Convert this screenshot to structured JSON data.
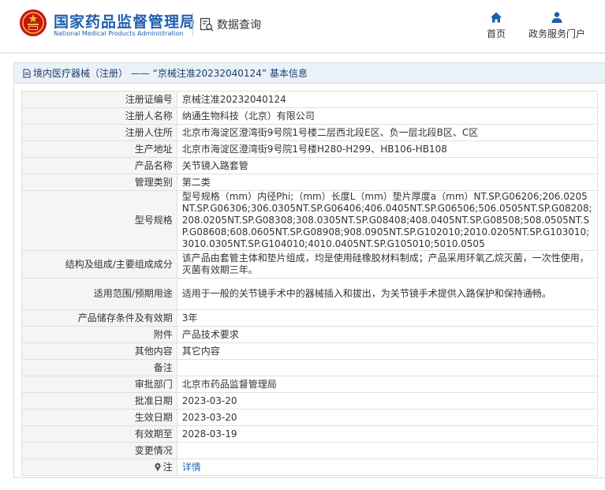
{
  "header": {
    "title": "国家药品监督管理局",
    "subtitle": "National Medical Products Administration",
    "data_query_label": "数据查询",
    "nav": [
      {
        "label": "首页",
        "icon": "home-icon"
      },
      {
        "label": "政务服务门户",
        "icon": "user-icon"
      }
    ]
  },
  "panel": {
    "title": "境内医疗器械（注册） —— “京械注准20232040124” 基本信息",
    "rows": [
      {
        "key": "注册证编号",
        "value": "京械注准20232040124"
      },
      {
        "key": "注册人名称",
        "value": "纳通生物科技（北京）有限公司"
      },
      {
        "key": "注册人住所",
        "value": "北京市海淀区澄湾街9号院1号楼二层西北段E区、负一层北段B区、C区"
      },
      {
        "key": "生产地址",
        "value": "北京市海淀区澄湾街9号院1号楼H280-H299、HB106-HB108"
      },
      {
        "key": "产品名称",
        "value": "关节镜入路套管"
      },
      {
        "key": "管理类别",
        "value": "第二类"
      },
      {
        "key": "型号规格",
        "value": "型号规格（mm）内径Phi;（mm）长度L（mm）垫片厚度a（mm）NT.SP.G06206;206.0205NT.SP.G06306;306.0305NT.SP.G06406;406.0405NT.SP.G06506;506.0505NT.SP.G08208;208.0205NT.SP.G08308;308.0305NT.SP.G08408;408.0405NT.SP.G08508;508.0505NT.SP.G08608;608.0605NT.SP.G08908;908.0905NT.SP.G102010;2010.0205NT.SP.G103010;3010.0305NT.SP.G104010;4010.0405NT.SP.G105010;5010.0505"
      },
      {
        "key": "结构及组成/主要组成成分",
        "value": "该产品由套管主体和垫片组成，均是使用硅橡胶材料制成；产品采用环氧乙烷灭菌，一次性使用，灭菌有效期三年。"
      },
      {
        "key": "适用范围/预期用途",
        "value": "适用于一般的关节镜手术中的器械插入和拔出，为关节镜手术提供入路保护和保持通畅。"
      },
      {
        "key": "产品储存条件及有效期",
        "value": "3年"
      },
      {
        "key": "附件",
        "value": "产品技术要求"
      },
      {
        "key": "其他内容",
        "value": "其它内容"
      },
      {
        "key": "备注",
        "value": ""
      },
      {
        "key": "审批部门",
        "value": "北京市药品监督管理局"
      },
      {
        "key": "批准日期",
        "value": "2023-03-20"
      },
      {
        "key": "生效日期",
        "value": "2023-03-20"
      },
      {
        "key": "有效期至",
        "value": "2028-03-19"
      },
      {
        "key": "变更情况",
        "value": ""
      },
      {
        "key": "注",
        "value": "详情",
        "icon": "pin-icon"
      }
    ]
  },
  "colors": {
    "brand_blue": "#1f5fae",
    "brand_red": "#c4161c",
    "link": "#2a6bbf",
    "title_bar": "#eaf1f8"
  }
}
